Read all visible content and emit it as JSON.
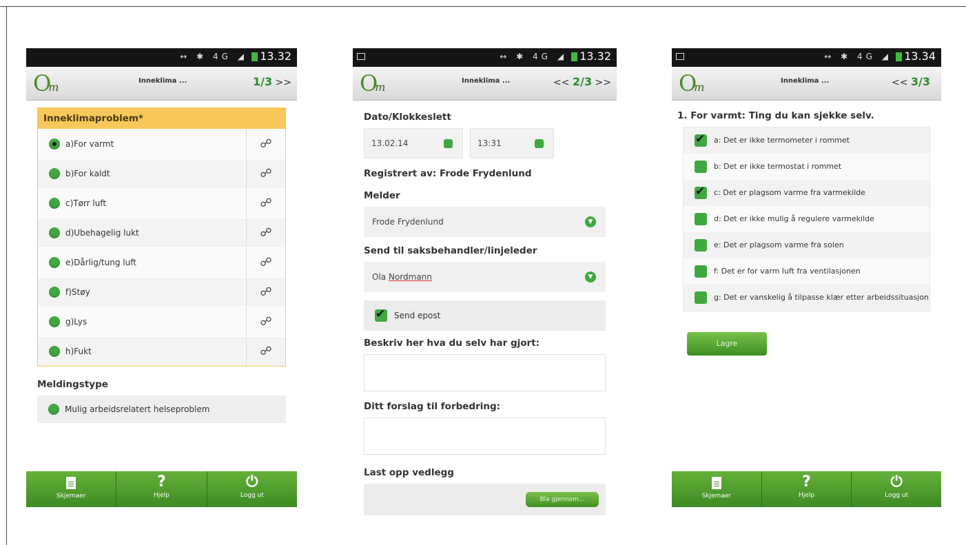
{
  "status": {
    "time_a": "13.32",
    "time_b": "13.32",
    "time_c": "13.34",
    "sys_icons": "↔ ✱ 4G ◢"
  },
  "app": {
    "logo_o": "O",
    "logo_m": "m",
    "title": "Inneklima ..."
  },
  "screen1": {
    "pager_current": "1/3",
    "pager_next": ">>",
    "problem_header": "Inneklimaproblem*",
    "problems": [
      {
        "label": "a)For varmt"
      },
      {
        "label": "b)For kaldt"
      },
      {
        "label": "c)Tørr luft"
      },
      {
        "label": "d)Ubehagelig lukt"
      },
      {
        "label": "e)Dårlig/tung luft"
      },
      {
        "label": "f)Støy"
      },
      {
        "label": "g)Lys"
      },
      {
        "label": "h)Fukt"
      }
    ],
    "link_glyph": "☍",
    "msgtype_heading": "Meldingstype",
    "msgtype_option": "Mulig arbeidsrelatert helseproblem"
  },
  "screen2": {
    "pager_prev": "<<",
    "pager_current": "2/3",
    "pager_next": ">>",
    "date_heading": "Dato/Klokkeslett",
    "date_value": "13.02.14",
    "time_value": "13:31",
    "registered_by": "Registrert av: Frode Frydenlund",
    "melder_heading": "Melder",
    "melder_value": "Frode Frydenlund",
    "sendto_heading": "Send til saksbehandler/linjeleder",
    "sendto_first": "Ola",
    "sendto_last": "Nordmann",
    "send_email_label": "Send epost",
    "describe_heading": "Beskriv her hva du selv har gjort:",
    "suggest_heading": "Ditt forslag til forbedring:",
    "upload_heading": "Last opp vedlegg",
    "browse_label": "Bla gjennom..."
  },
  "screen3": {
    "pager_prev": "<<",
    "pager_current": "3/3",
    "heading": "1. For varmt: Ting du kan sjekke selv.",
    "items": [
      {
        "text": "a: Det er ikke termometer i rommet",
        "checked": true
      },
      {
        "text": "b: Det er ikke termostat i rommet",
        "checked": false
      },
      {
        "text": "c: Det er plagsom varme fra varmekilde",
        "checked": true
      },
      {
        "text": "d: Det er ikke mulig å regulere varmekilde",
        "checked": false
      },
      {
        "text": "e: Det er plagsom varme fra solen",
        "checked": false
      },
      {
        "text": "f: Det er for varm luft fra ventilasjonen",
        "checked": false
      },
      {
        "text": "g: Det er vanskelig å tilpasse klær etter arbeidssituasjon",
        "checked": false
      }
    ],
    "save_label": "Lagre"
  },
  "bottom_nav": {
    "screens_label": "Skjemaer",
    "help_label": "Hjelp",
    "logout_label": "Logg ut",
    "help_glyph": "?",
    "logout_glyph": "⏻"
  },
  "colors": {
    "accent_green": "#3fa840",
    "header_yellow": "#f8c85a",
    "bar_green": "#4f9b2e"
  }
}
